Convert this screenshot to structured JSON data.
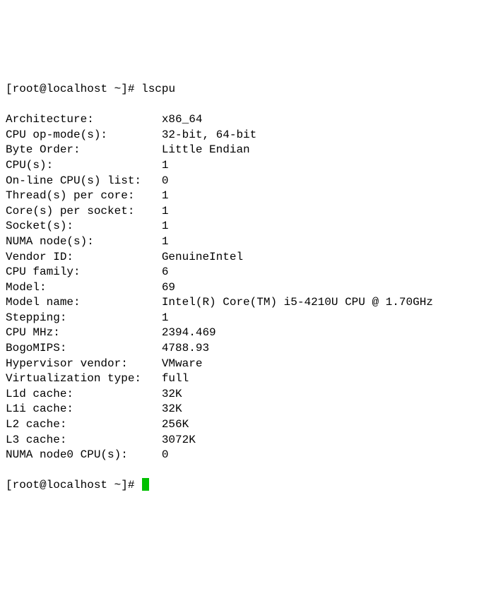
{
  "prompt1": {
    "user": "root",
    "host": "localhost",
    "path": "~",
    "symbol": "#",
    "command": "lscpu"
  },
  "rows": [
    {
      "label": "Architecture:",
      "value": "x86_64"
    },
    {
      "label": "CPU op-mode(s):",
      "value": "32-bit, 64-bit"
    },
    {
      "label": "Byte Order:",
      "value": "Little Endian"
    },
    {
      "label": "CPU(s):",
      "value": "1"
    },
    {
      "label": "On-line CPU(s) list:",
      "value": "0"
    },
    {
      "label": "Thread(s) per core:",
      "value": "1"
    },
    {
      "label": "Core(s) per socket:",
      "value": "1"
    },
    {
      "label": "Socket(s):",
      "value": "1"
    },
    {
      "label": "NUMA node(s):",
      "value": "1"
    },
    {
      "label": "Vendor ID:",
      "value": "GenuineIntel"
    },
    {
      "label": "CPU family:",
      "value": "6"
    },
    {
      "label": "Model:",
      "value": "69"
    },
    {
      "label": "Model name:",
      "value": "Intel(R) Core(TM) i5-4210U CPU @ 1.70GHz"
    },
    {
      "label": "Stepping:",
      "value": "1"
    },
    {
      "label": "CPU MHz:",
      "value": "2394.469"
    },
    {
      "label": "BogoMIPS:",
      "value": "4788.93"
    },
    {
      "label": "Hypervisor vendor:",
      "value": "VMware"
    },
    {
      "label": "Virtualization type:",
      "value": "full"
    },
    {
      "label": "L1d cache:",
      "value": "32K"
    },
    {
      "label": "L1i cache:",
      "value": "32K"
    },
    {
      "label": "L2 cache:",
      "value": "256K"
    },
    {
      "label": "L3 cache:",
      "value": "3072K"
    },
    {
      "label": "NUMA node0 CPU(s):",
      "value": "0"
    }
  ],
  "prompt2": {
    "text": "[root@localhost ~]# "
  }
}
